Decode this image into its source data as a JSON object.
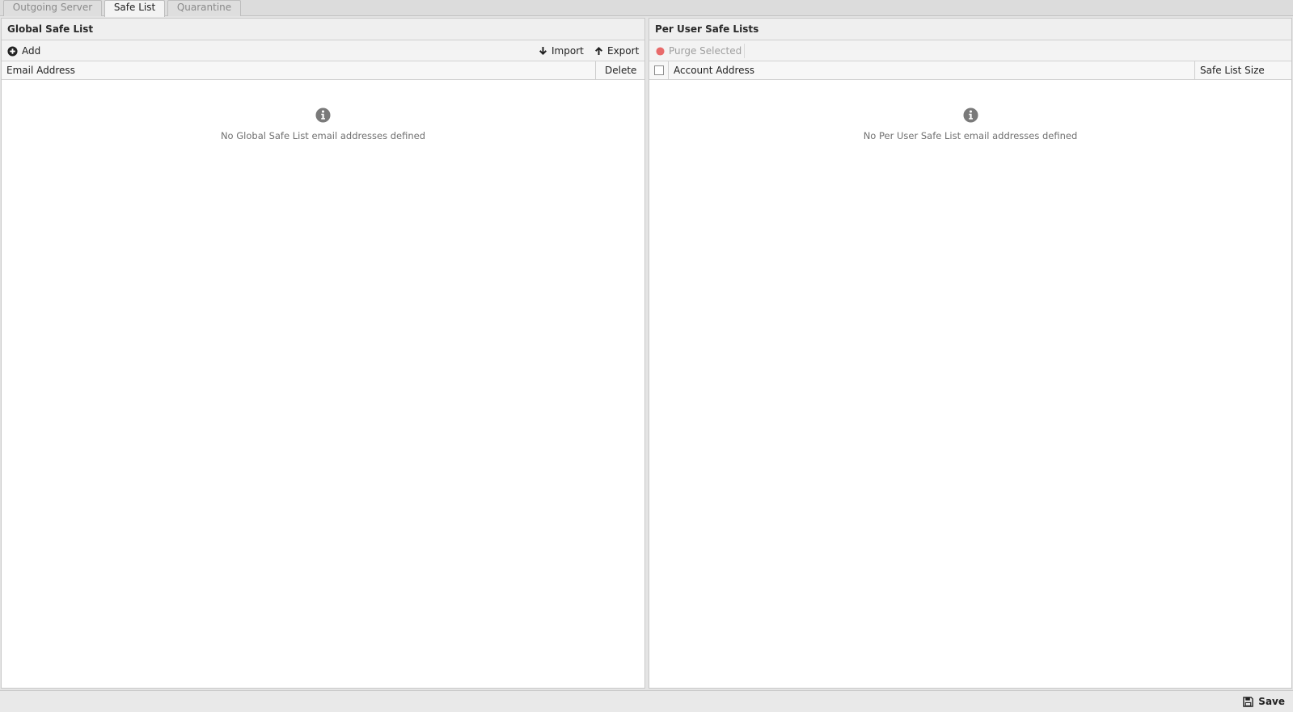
{
  "tabs": [
    {
      "label": "Outgoing Server",
      "active": false
    },
    {
      "label": "Safe List",
      "active": true
    },
    {
      "label": "Quarantine",
      "active": false
    }
  ],
  "global": {
    "title": "Global Safe List",
    "toolbar": {
      "add": "Add",
      "import": "Import",
      "export": "Export"
    },
    "columns": {
      "email": "Email Address",
      "delete": "Delete"
    },
    "empty_message": "No Global Safe List email addresses defined"
  },
  "per_user": {
    "title": "Per User Safe Lists",
    "toolbar": {
      "purge": "Purge Selected"
    },
    "columns": {
      "account": "Account Address",
      "size": "Safe List Size"
    },
    "empty_message": "No Per User Safe List email addresses defined"
  },
  "footer": {
    "save": "Save"
  },
  "colors": {
    "purge_icon": "#e86a6a",
    "info_icon": "#7a7a7a"
  }
}
